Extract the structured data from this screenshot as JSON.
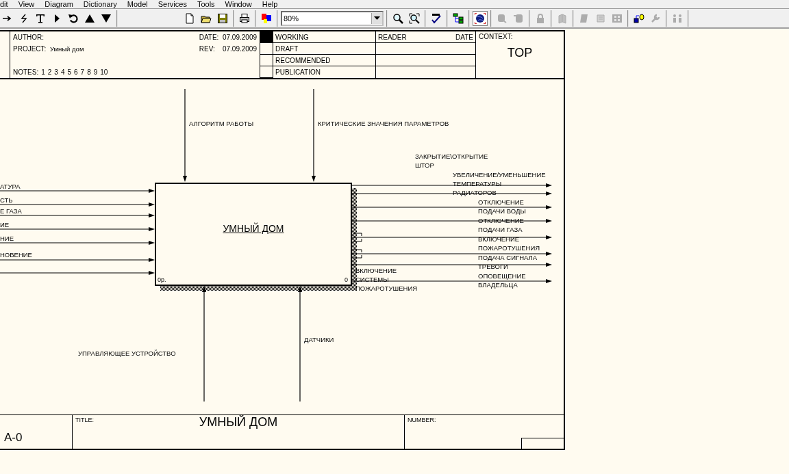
{
  "menu": [
    "dit",
    "View",
    "Diagram",
    "Dictionary",
    "Model",
    "Services",
    "Tools",
    "Window",
    "Help"
  ],
  "toolbar": {
    "groups": [
      {
        "items": [
          {
            "kind": "button",
            "disabled": false,
            "pressed": false
          },
          {
            "kind": "button",
            "disabled": false,
            "pressed": false
          },
          {
            "kind": "button",
            "disabled": false,
            "pressed": false
          },
          {
            "kind": "button",
            "disabled": false,
            "pressed": false
          },
          {
            "kind": "button",
            "disabled": false,
            "pressed": false
          },
          {
            "kind": "button",
            "disabled": false,
            "pressed": false
          },
          {
            "kind": "button",
            "disabled": false,
            "pressed": false
          }
        ]
      },
      {
        "items": [
          {
            "kind": "button",
            "disabled": false,
            "pressed": false
          },
          {
            "kind": "button",
            "disabled": false,
            "pressed": false
          },
          {
            "kind": "button",
            "disabled": false,
            "pressed": false
          }
        ]
      },
      {
        "items": [
          {
            "kind": "button",
            "disabled": false,
            "pressed": false
          }
        ]
      },
      {
        "items": [
          {
            "kind": "button",
            "disabled": false,
            "pressed": false
          }
        ]
      },
      {
        "items": [
          {
            "kind": "zoom",
            "value": "80%"
          }
        ]
      },
      {
        "items": [
          {
            "kind": "button",
            "disabled": false,
            "pressed": false
          },
          {
            "kind": "button",
            "disabled": false,
            "pressed": false
          }
        ]
      },
      {
        "items": [
          {
            "kind": "button",
            "disabled": false,
            "pressed": false
          }
        ]
      },
      {
        "items": [
          {
            "kind": "button",
            "disabled": false,
            "pressed": false
          }
        ]
      },
      {
        "items": [
          {
            "kind": "button",
            "disabled": false,
            "pressed": true
          }
        ]
      },
      {
        "items": [
          {
            "kind": "button",
            "disabled": true,
            "pressed": false
          },
          {
            "kind": "button",
            "disabled": true,
            "pressed": false
          }
        ]
      },
      {
        "items": [
          {
            "kind": "button",
            "disabled": true,
            "pressed": false
          }
        ]
      },
      {
        "items": [
          {
            "kind": "button",
            "disabled": true,
            "pressed": false
          }
        ]
      },
      {
        "items": [
          {
            "kind": "button",
            "disabled": true,
            "pressed": false
          },
          {
            "kind": "button",
            "disabled": true,
            "pressed": false
          },
          {
            "kind": "button",
            "disabled": true,
            "pressed": false
          }
        ]
      },
      {
        "items": [
          {
            "kind": "button",
            "disabled": false,
            "pressed": false
          },
          {
            "kind": "button",
            "disabled": true,
            "pressed": false
          }
        ]
      },
      {
        "items": [
          {
            "kind": "button",
            "disabled": true,
            "pressed": false
          }
        ]
      }
    ]
  },
  "header": {
    "author_label": "AUTHOR:",
    "project_label": "PROJECT:",
    "project": "Умный дом",
    "date_label": "DATE:",
    "date": "07.09.2009",
    "rev_label": "REV:",
    "rev": "07.09.2009",
    "notes_label": "NOTES:",
    "notes": [
      "1",
      "2",
      "3",
      "4",
      "5",
      "6",
      "7",
      "8",
      "9",
      "10"
    ],
    "statuses": [
      {
        "label": "WORKING",
        "selected": true
      },
      {
        "label": "DRAFT",
        "selected": false
      },
      {
        "label": "RECOMMENDED",
        "selected": false
      },
      {
        "label": "PUBLICATION",
        "selected": false
      }
    ],
    "reader_label": "READER",
    "reader_date_label": "DATE",
    "context_label": "CONTEXT:",
    "context": "TOP"
  },
  "diagram": {
    "activity": {
      "name": "УМНЫЙ ДОМ",
      "cost": "0р.",
      "number": "0"
    },
    "controls": [
      {
        "label": "АЛГОРИТМ РАБОТЫ"
      },
      {
        "label": "КРИТИЧЕСКИЕ ЗНАЧЕНИЯ ПАРАМЕТРОВ"
      }
    ],
    "inputs": [
      {
        "kind": "labeled",
        "label": "АТУРА"
      },
      {
        "kind": "labeled",
        "label": "СТЬ"
      },
      {
        "kind": "labeled",
        "label": "Е ГАЗА"
      },
      {
        "kind": "labeled",
        "label": "ИЕ"
      },
      {
        "kind": "labeled",
        "label": "НИЕ"
      },
      {
        "kind": "labeled",
        "label": "НОВЕНИЕ"
      },
      {
        "kind": "unlabeled"
      }
    ],
    "outputs": [
      {
        "label": "ЗАКРЫТИЕ\\ОТКРЫТИЕ\nШТОР"
      },
      {
        "label": "УВЕЛИЧЕНИЕ/УМЕНЬШЕНИЕ\nТЕМПЕРАТУРЫ\nРАДИАТОРОВ"
      },
      {
        "label": "ОТКЛЮЧЕНИЕ\nПОДАЧИ ВОДЫ"
      },
      {
        "label": "ОТКЛЮЧЕНИЕ\nПОДАЧИ ГАЗА"
      },
      {
        "label": "ВКЛЮЧЕНИЕ\nПОЖАРОТУШЕНИЯ"
      },
      {
        "label": "ПОДАЧА СИГНАЛА\nТРЕВОГИ"
      },
      {
        "label": "ВКЛЮЧЕНИЕ\nСИСТЕМЫ\nПОЖАРОТУШЕНИЯ"
      },
      {
        "label": "ОПОВЕЩЕНИЕ\nВЛАДЕЛЬЦА"
      }
    ],
    "mechanisms": [
      {
        "label": "УПРАВЛЯЮЩЕЕ УСТРОЙСТВО"
      },
      {
        "label": "ДАТЧИКИ"
      }
    ]
  },
  "footer": {
    "node": "A-0",
    "title_label": "TITLE:",
    "title": "УМНЫЙ ДОМ",
    "number_label": "NUMBER:"
  }
}
